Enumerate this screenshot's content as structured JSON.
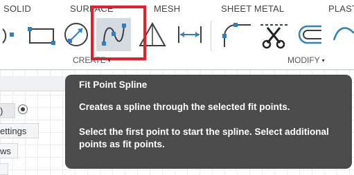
{
  "workspace_tabs": [
    "SOLID",
    "SURFACE",
    "MESH",
    "SHEET METAL",
    "PLAST"
  ],
  "toolbar": {
    "create_label": "CREATE",
    "modify_label": "MODIFY",
    "tools": [
      {
        "icon": "arc-icon",
        "active": false
      },
      {
        "icon": "rectangle-icon",
        "active": false
      },
      {
        "icon": "circle-diameter-icon",
        "active": false
      },
      {
        "icon": "fit-point-spline-icon",
        "active": true
      },
      {
        "icon": "polygon-triangle-icon",
        "active": false
      },
      {
        "icon": "dimension-icon",
        "active": false
      },
      {
        "icon": "fillet-icon",
        "active": false
      },
      {
        "icon": "trim-scissors-icon",
        "active": false
      },
      {
        "icon": "offset-icon",
        "active": false
      },
      {
        "icon": "curve-icon",
        "active": false
      }
    ],
    "caret": "▾"
  },
  "browser_panel": {
    "settings_label": "ettings",
    "views_label": "ws",
    "timeline_label": ")"
  },
  "tooltip": {
    "title": "Fit Point Spline",
    "description": "Creates a spline through the selected fit points.",
    "instructions": "Select the first point to start the spline. Select additional points as fit points."
  },
  "colors": {
    "accent_blue": "#2f7fc1",
    "highlight_red": "#e5202a",
    "tooltip_bg": "#4b4b4b",
    "active_tool_bg": "#d5dbe1"
  }
}
